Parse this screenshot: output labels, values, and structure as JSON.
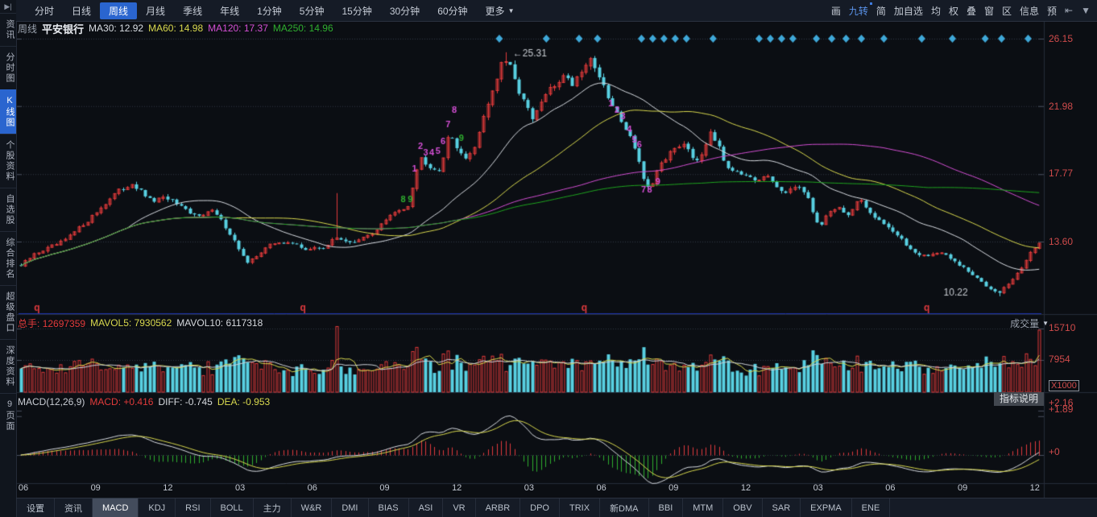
{
  "icons": {
    "sidebar_collapse": "▶|",
    "caret_down": "▼",
    "jump_left": "⇤"
  },
  "toolbar": {
    "period_tabs": [
      "分时",
      "日线",
      "周线",
      "月线",
      "季线",
      "年线",
      "1分钟",
      "5分钟",
      "15分钟",
      "30分钟",
      "60分钟"
    ],
    "selected_tab": "周线",
    "more_label": "更多",
    "right_items": [
      "画",
      "九转",
      "简",
      "加自选",
      "均",
      "权",
      "叠",
      "窗",
      "区",
      "信息",
      "预"
    ],
    "highlight_item": "九转"
  },
  "sidebar": {
    "items": [
      "资讯",
      "分时图",
      "K线图",
      "个股资料",
      "自选股",
      "综合排名",
      "超级盘口",
      "深度资料",
      "9页面"
    ],
    "selected": "K线图"
  },
  "chart_header": {
    "period": "周线",
    "symbol": "平安银行",
    "ma30_label": "MA30:",
    "ma30_value": "12.92",
    "ma60_label": "MA60:",
    "ma60_value": "14.98",
    "ma120_label": "MA120:",
    "ma120_value": "17.37",
    "ma250_label": "MA250:",
    "ma250_value": "14.96"
  },
  "volume_header": {
    "label": "总手:",
    "value": "12697359",
    "mavol5_label": "MAVOL5:",
    "mavol5_value": "7930562",
    "mavol10_label": "MAVOL10:",
    "mavol10_value": "6117318",
    "dropdown_label": "成交量"
  },
  "macd_header": {
    "formula": "MACD(12,26,9)",
    "macd_label": "MACD:",
    "macd_value": "+0.416",
    "diff_label": "DIFF:",
    "diff_value": "-0.745",
    "dea_label": "DEA:",
    "dea_value": "-0.953"
  },
  "indicator_tooltip": "指标说明",
  "bottom_tabs": {
    "items": [
      "设置",
      "资讯",
      "MACD",
      "KDJ",
      "RSI",
      "BOLL",
      "主力",
      "W&R",
      "DMI",
      "BIAS",
      "ASI",
      "VR",
      "ARBR",
      "DPO",
      "TRIX",
      "新DMA",
      "BBI",
      "MTM",
      "OBV",
      "SAR",
      "EXPMA",
      "ENE"
    ],
    "selected": "MACD"
  },
  "chart_data": {
    "type": "candlestick",
    "title": "平安银行 周线",
    "x_tick_labels": [
      "06",
      "09",
      "12",
      "03",
      "06",
      "09",
      "12",
      "03",
      "06",
      "09",
      "12",
      "03",
      "06",
      "09",
      "12"
    ],
    "price_axis": {
      "labels": [
        "26.15",
        "21.98",
        "17.77",
        "13.60"
      ],
      "values": [
        26.15,
        21.98,
        17.77,
        13.6
      ]
    },
    "volume_axis": {
      "labels": [
        "15710",
        "7954"
      ],
      "values": [
        15710,
        7954
      ],
      "unit_label": "X1000",
      "max": 16300
    },
    "macd_axis": {
      "labels": [
        "+2.16",
        "+1.89",
        "+0"
      ],
      "values": [
        2.16,
        1.89,
        0
      ]
    },
    "num_candles": 230,
    "close_path": [
      [
        0.0,
        12.1
      ],
      [
        0.014,
        12.85
      ],
      [
        0.042,
        13.6
      ],
      [
        0.069,
        15.1
      ],
      [
        0.093,
        16.6
      ],
      [
        0.109,
        17.2
      ],
      [
        0.128,
        16.1
      ],
      [
        0.144,
        16.3
      ],
      [
        0.168,
        15.2
      ],
      [
        0.189,
        15.5
      ],
      [
        0.203,
        14.35
      ],
      [
        0.223,
        12.2
      ],
      [
        0.242,
        13.35
      ],
      [
        0.262,
        13.6
      ],
      [
        0.28,
        13.1
      ],
      [
        0.297,
        13.25
      ],
      [
        0.311,
        13.85
      ],
      [
        0.327,
        13.5
      ],
      [
        0.345,
        14.1
      ],
      [
        0.359,
        15.0
      ],
      [
        0.37,
        15.5
      ],
      [
        0.38,
        15.85
      ],
      [
        0.386,
        17.5
      ],
      [
        0.392,
        18.8
      ],
      [
        0.401,
        18.3
      ],
      [
        0.411,
        18.0
      ],
      [
        0.421,
        20.3
      ],
      [
        0.43,
        19.3
      ],
      [
        0.437,
        18.6
      ],
      [
        0.447,
        19.7
      ],
      [
        0.455,
        21.6
      ],
      [
        0.464,
        23.1
      ],
      [
        0.472,
        24.6
      ],
      [
        0.478,
        24.8
      ],
      [
        0.486,
        23.3
      ],
      [
        0.494,
        22.3
      ],
      [
        0.502,
        21.1
      ],
      [
        0.508,
        21.8
      ],
      [
        0.516,
        22.8
      ],
      [
        0.526,
        23.3
      ],
      [
        0.533,
        24.0
      ],
      [
        0.541,
        23.3
      ],
      [
        0.551,
        24.3
      ],
      [
        0.559,
        24.9
      ],
      [
        0.566,
        24.1
      ],
      [
        0.574,
        22.8
      ],
      [
        0.582,
        21.8
      ],
      [
        0.59,
        21.1
      ],
      [
        0.598,
        20.1
      ],
      [
        0.604,
        19.3
      ],
      [
        0.612,
        17.3
      ],
      [
        0.618,
        16.6
      ],
      [
        0.626,
        18.3
      ],
      [
        0.634,
        18.8
      ],
      [
        0.644,
        19.5
      ],
      [
        0.653,
        19.7
      ],
      [
        0.661,
        18.6
      ],
      [
        0.669,
        19.1
      ],
      [
        0.677,
        20.5
      ],
      [
        0.684,
        19.6
      ],
      [
        0.692,
        18.3
      ],
      [
        0.703,
        18.0
      ],
      [
        0.713,
        17.6
      ],
      [
        0.722,
        17.2
      ],
      [
        0.732,
        17.7
      ],
      [
        0.742,
        17.0
      ],
      [
        0.752,
        16.5
      ],
      [
        0.763,
        17.2
      ],
      [
        0.773,
        16.2
      ],
      [
        0.784,
        14.4
      ],
      [
        0.793,
        15.5
      ],
      [
        0.803,
        15.7
      ],
      [
        0.813,
        15.2
      ],
      [
        0.823,
        16.2
      ],
      [
        0.832,
        15.5
      ],
      [
        0.842,
        15.0
      ],
      [
        0.852,
        14.5
      ],
      [
        0.862,
        13.85
      ],
      [
        0.872,
        13.2
      ],
      [
        0.881,
        12.85
      ],
      [
        0.891,
        12.7
      ],
      [
        0.902,
        13.0
      ],
      [
        0.911,
        12.6
      ],
      [
        0.92,
        12.2
      ],
      [
        0.931,
        11.7
      ],
      [
        0.941,
        11.2
      ],
      [
        0.952,
        10.7
      ],
      [
        0.961,
        10.5
      ],
      [
        0.97,
        11.0
      ],
      [
        0.98,
        11.7
      ],
      [
        0.99,
        12.85
      ],
      [
        1.0,
        13.5
      ]
    ],
    "wick_spikes": [
      {
        "t": 0.311,
        "high": 16.6
      }
    ],
    "forced": {
      "peak": {
        "t": 0.478,
        "high": 25.31
      },
      "low": {
        "t": 0.961,
        "low": 10.22
      },
      "last_close": 13.5
    },
    "volume_spikes": [
      {
        "t": 0.311,
        "v": 16200
      },
      {
        "t": 1.0,
        "v": 15300
      }
    ],
    "ma_lines": [
      {
        "name": "MA30",
        "period": 25,
        "color": "#d8dce2"
      },
      {
        "name": "MA60",
        "period": 49,
        "color": "#d9d94e"
      },
      {
        "name": "MA120",
        "period": 99,
        "color": "#d44fd4"
      },
      {
        "name": "MA250",
        "period": 205,
        "color": "#1fa51f"
      }
    ],
    "mavol_lines": [
      {
        "period": 5,
        "color": "#d9d94e"
      },
      {
        "period": 10,
        "color": "#cfd3d9"
      }
    ],
    "macd_params": {
      "fast": 10,
      "slow": 21,
      "signal": 7,
      "diff_color": "#d8dce2",
      "dea_color": "#d9d94e",
      "pos_color": "#e03a3e",
      "neg_color": "#2fae2f"
    },
    "colors": {
      "up": "#e23b3b",
      "down": "#58d0e2",
      "grid": "#343b47",
      "diamond": "#3fa8d8",
      "annotation": "#c8ccd2",
      "q": "#e03a3e",
      "pane_border": "#262d3a",
      "blue_baseline": "#1f35b0",
      "tick": "#4a5160"
    },
    "annotations": {
      "peak_label": {
        "text": "←25.31",
        "t": 0.481,
        "price": 25.2
      },
      "low_label": {
        "text": "10.22",
        "t": 0.928,
        "price": 10.45
      },
      "q_marks": {
        "text": "q",
        "t": [
          0.018,
          0.278,
          0.553,
          0.888
        ]
      },
      "diamonds_t": [
        0.47,
        0.516,
        0.548,
        0.566,
        0.609,
        0.62,
        0.631,
        0.642,
        0.653,
        0.679,
        0.724,
        0.735,
        0.746,
        0.757,
        0.78,
        0.795,
        0.809,
        0.824,
        0.846,
        0.883,
        0.913,
        0.945,
        0.961,
        0.987
      ],
      "digits": [
        {
          "t": 0.387,
          "p": 18.1,
          "s": "1",
          "c": "#d44fd4"
        },
        {
          "t": 0.393,
          "p": 19.5,
          "s": "2",
          "c": "#d44fd4"
        },
        {
          "t": 0.398,
          "p": 19.1,
          "s": "3",
          "c": "#d44fd4"
        },
        {
          "t": 0.404,
          "p": 19.1,
          "s": "4",
          "c": "#d44fd4"
        },
        {
          "t": 0.41,
          "p": 19.2,
          "s": "5",
          "c": "#d44fd4"
        },
        {
          "t": 0.415,
          "p": 19.8,
          "s": "6",
          "c": "#d44fd4"
        },
        {
          "t": 0.42,
          "p": 20.8,
          "s": "7",
          "c": "#d44fd4"
        },
        {
          "t": 0.426,
          "p": 21.7,
          "s": "8",
          "c": "#d44fd4"
        },
        {
          "t": 0.433,
          "p": 20.0,
          "s": "9",
          "c": "#2fae2f"
        },
        {
          "t": 0.376,
          "p": 16.2,
          "s": "8",
          "c": "#2fae2f"
        },
        {
          "t": 0.383,
          "p": 16.2,
          "s": "9",
          "c": "#2fae2f"
        },
        {
          "t": 0.579,
          "p": 22.1,
          "s": "1",
          "c": "#d44fd4"
        },
        {
          "t": 0.585,
          "p": 21.7,
          "s": "2",
          "c": "#d44fd4"
        },
        {
          "t": 0.591,
          "p": 21.3,
          "s": "3",
          "c": "#d44fd4"
        },
        {
          "t": 0.597,
          "p": 20.5,
          "s": "4",
          "c": "#d44fd4"
        },
        {
          "t": 0.602,
          "p": 19.9,
          "s": "5",
          "c": "#d44fd4"
        },
        {
          "t": 0.607,
          "p": 19.6,
          "s": "6",
          "c": "#d44fd4"
        },
        {
          "t": 0.611,
          "p": 16.8,
          "s": "7",
          "c": "#d44fd4"
        },
        {
          "t": 0.617,
          "p": 16.8,
          "s": "8",
          "c": "#d44fd4"
        },
        {
          "t": 0.625,
          "p": 17.3,
          "s": "9",
          "c": "#d44fd4"
        }
      ]
    }
  }
}
